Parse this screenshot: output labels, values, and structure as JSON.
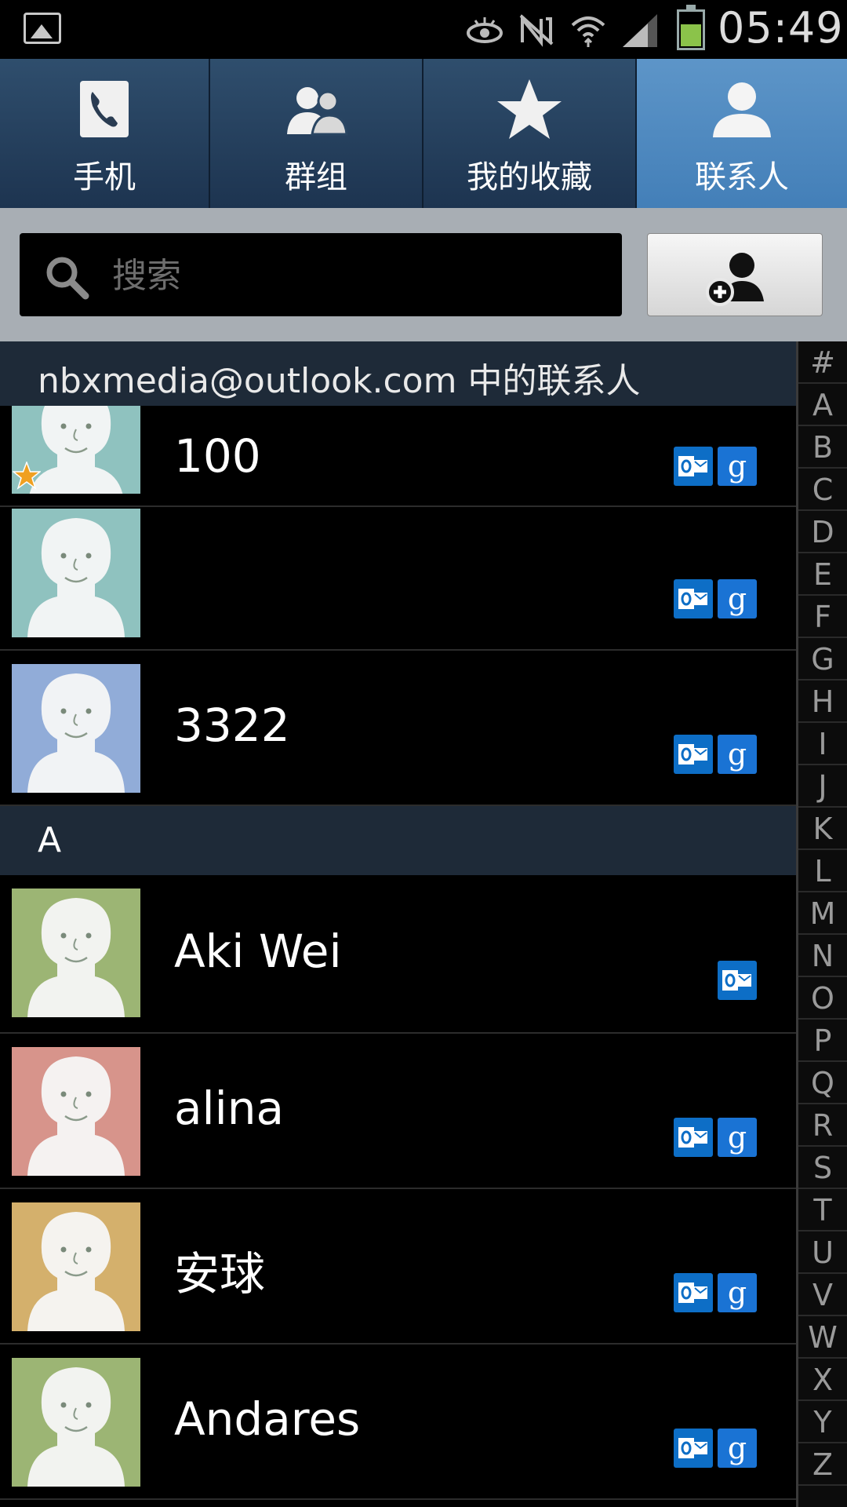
{
  "status_bar": {
    "time": "05:49",
    "icons": [
      "gallery-icon",
      "smart-stay-eye-icon",
      "no-nfc-icon",
      "wifi-icon",
      "signal-icon",
      "battery-icon"
    ],
    "battery_color": "#8bc34a"
  },
  "tabs": [
    {
      "label": "手机",
      "icon": "phone-icon",
      "active": false
    },
    {
      "label": "群组",
      "icon": "groups-icon",
      "active": false
    },
    {
      "label": "我的收藏",
      "icon": "star-icon",
      "active": false
    },
    {
      "label": "联系人",
      "icon": "person-icon",
      "active": true
    }
  ],
  "search": {
    "placeholder": "搜索"
  },
  "add_contact_icon": "add-contact-icon",
  "account_header": "nbxmedia@outlook.com 中的联系人",
  "contacts": [
    {
      "name": "100",
      "avatar_bg": "#8fc2bf",
      "favorite": true,
      "accounts": [
        "outlook",
        "google"
      ]
    },
    {
      "name": "",
      "avatar_bg": "#8fc2bf",
      "favorite": false,
      "accounts": [
        "outlook",
        "google"
      ]
    },
    {
      "name": "3322",
      "avatar_bg": "#91acd8",
      "favorite": false,
      "accounts": [
        "outlook",
        "google"
      ]
    },
    {
      "section": "A"
    },
    {
      "name": "Aki Wei",
      "avatar_bg": "#9cb574",
      "favorite": false,
      "accounts": [
        "outlook"
      ]
    },
    {
      "name": "alina",
      "avatar_bg": "#d7948b",
      "favorite": false,
      "accounts": [
        "outlook",
        "google"
      ]
    },
    {
      "name": "安球",
      "avatar_bg": "#d4b06c",
      "favorite": false,
      "accounts": [
        "outlook",
        "google"
      ]
    },
    {
      "name": "Andares",
      "avatar_bg": "#9cb574",
      "favorite": false,
      "accounts": [
        "outlook",
        "google"
      ]
    }
  ],
  "index_letters": [
    "#",
    "A",
    "B",
    "C",
    "D",
    "E",
    "F",
    "G",
    "H",
    "I",
    "J",
    "K",
    "L",
    "M",
    "N",
    "O",
    "P",
    "Q",
    "R",
    "S",
    "T",
    "U",
    "V",
    "W",
    "X",
    "Y",
    "Z"
  ],
  "google_badge_glyph": "g"
}
